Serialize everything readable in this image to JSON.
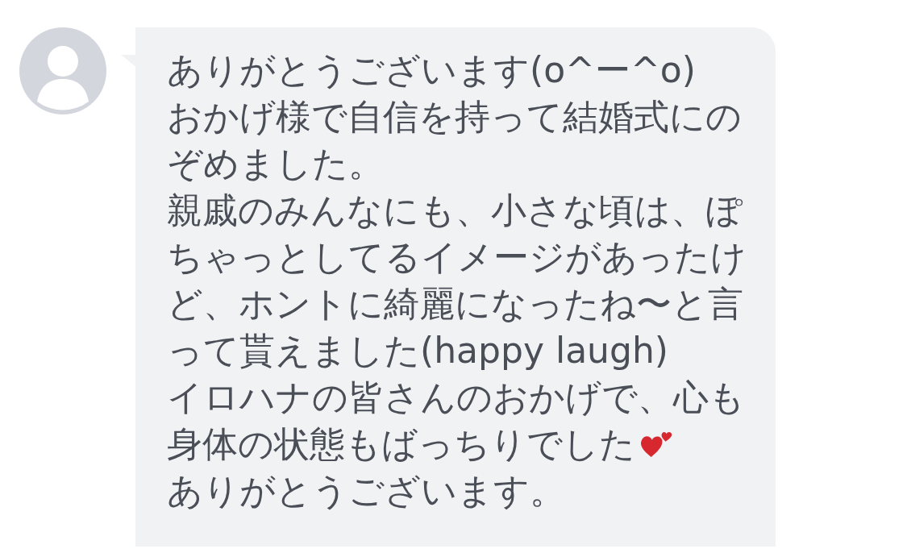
{
  "message": {
    "lines": [
      {
        "text": "ありがとうございます(o^ー^o)",
        "kind": "plain"
      },
      {
        "text": "おかげ様で自信を持って結婚式にの",
        "kind": "plain"
      },
      {
        "text": "ぞめました。",
        "kind": "plain"
      },
      {
        "text": "親戚のみんなにも、小さな頃は、ぽ",
        "kind": "plain"
      },
      {
        "text": "ちゃっとしてるイメージがあったけ",
        "kind": "plain"
      },
      {
        "text": "ど、ホントに綺麗になったね〜と言",
        "kind": "plain"
      },
      {
        "text": "って貰えました(happy laugh)",
        "kind": "plain"
      },
      {
        "text": "イロハナの皆さんのおかげで、心も",
        "kind": "plain"
      },
      {
        "text": "身体の状態もばっちりでした",
        "kind": "hearts"
      },
      {
        "text": "ありがとうございます。",
        "kind": "plain"
      }
    ]
  }
}
